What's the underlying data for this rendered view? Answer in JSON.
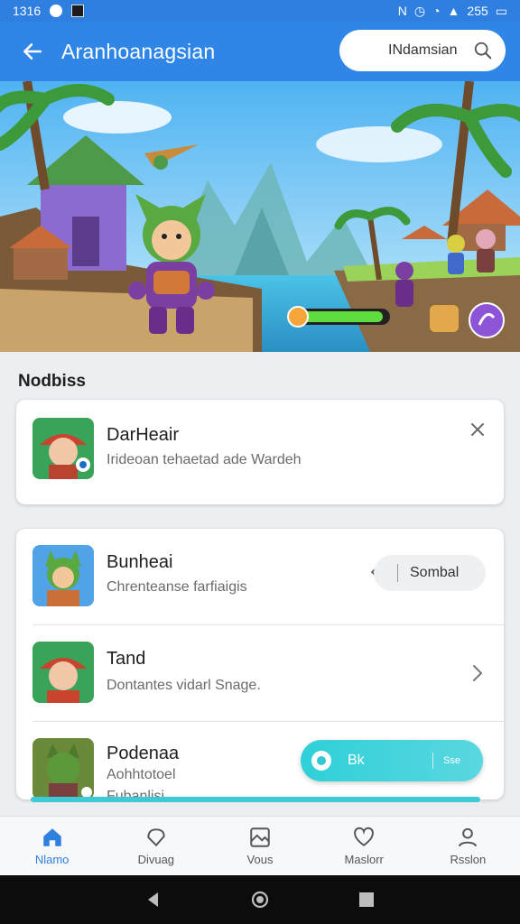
{
  "status_bar": {
    "time": "1316",
    "battery": "255"
  },
  "app_bar": {
    "title": "Aranhoanagsian",
    "search": {
      "value": "INdamsian"
    }
  },
  "section": {
    "title": "Nodbiss"
  },
  "items": [
    {
      "name": "DarHeair",
      "sub": "Irideoan tehaetad ade Wardeh"
    },
    {
      "name": "Bunheai",
      "sub": "Chrenteanse farfiaigis",
      "action": "Sombal"
    },
    {
      "name": "Tand",
      "sub": "Dontantes vidarl Snage."
    },
    {
      "name": "Podenaa",
      "sub": "Aohhtotoel",
      "sub2": "Fubanlisi"
    }
  ],
  "fab": {
    "label": "Bk",
    "extra": "Sse"
  },
  "bottom_nav": [
    {
      "label": "Nlamo",
      "icon": "home-icon",
      "active": true
    },
    {
      "label": "Divuag",
      "icon": "tag-icon"
    },
    {
      "label": "Vous",
      "icon": "gallery-icon"
    },
    {
      "label": "Maslorr",
      "icon": "heart-icon"
    },
    {
      "label": "Rsslon",
      "icon": "person-icon"
    }
  ],
  "colors": {
    "primary": "#2f86e6",
    "accent": "#3dc9d6",
    "card": "#ffffff",
    "background": "#eceef1"
  }
}
